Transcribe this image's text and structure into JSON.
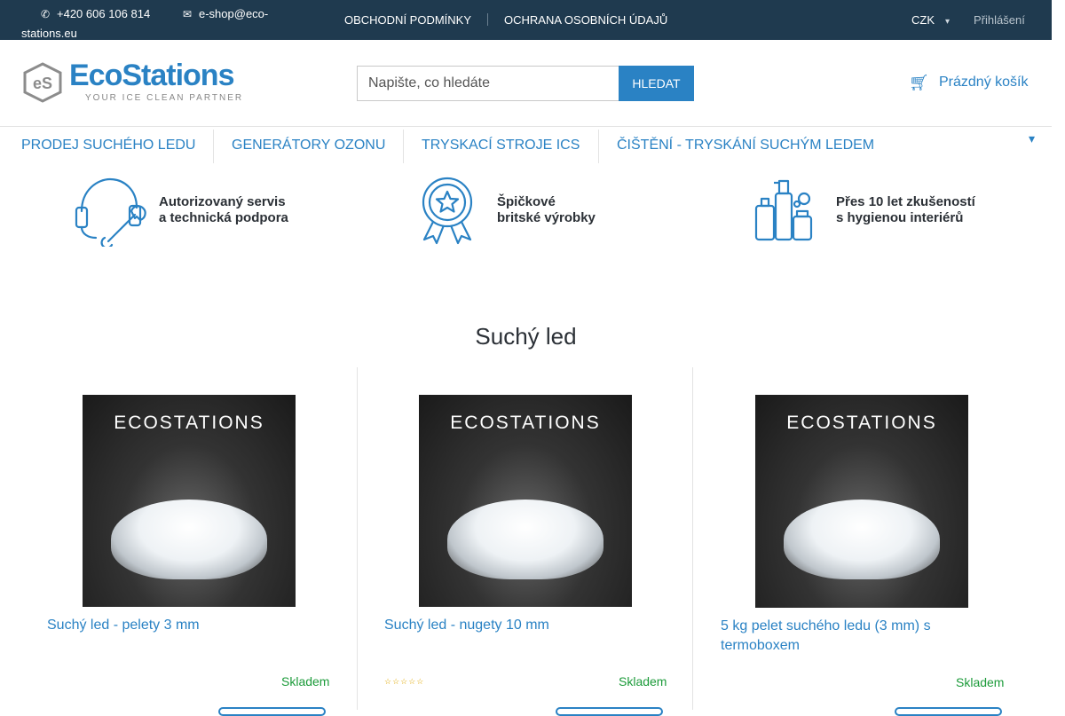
{
  "topbar": {
    "phone": "+420 606 106 814",
    "email_line1": "e-shop@eco-",
    "email_line2": "stations.eu",
    "links": [
      "OBCHODNÍ PODMÍNKY",
      "OCHRANA OSOBNÍCH ÚDAJŮ"
    ],
    "currency": "CZK",
    "login": "Přihlášení",
    "icons": {
      "phone": "phone-icon",
      "email": "envelope-icon",
      "currency_caret": "chevron-down-icon"
    }
  },
  "header": {
    "logo_word": "EcoStations",
    "logo_tagline": "YOUR ICE CLEAN PARTNER",
    "search_placeholder": "Napište, co hledáte",
    "search_button": "HLEDAT",
    "cart_label": "Prázdný košík",
    "cart_icon": "cart-icon"
  },
  "nav": {
    "items": [
      "PRODEJ SUCHÉHO LEDU",
      "GENERÁTORY OZONU",
      "TRYSKACÍ STROJE ICS",
      "ČIŠTĚNÍ - TRYSKÁNÍ SUCHÝM LEDEM"
    ],
    "more_icon": "chevron-down-icon"
  },
  "benefits": [
    {
      "line1": "Autorizovaný servis",
      "line2": "a technická podpora",
      "icon": "headset-wrench-icon"
    },
    {
      "line1": "Špičkové",
      "line2": "britské výrobky",
      "icon": "award-badge-icon"
    },
    {
      "line1": "Přes 10 let zkušeností",
      "line2": "s hygienou interiérů",
      "icon": "cleaning-bottles-icon"
    }
  ],
  "section_title": "Suchý led",
  "products": [
    {
      "name_line1": "Suchý led - pelety 3 mm",
      "name_line2": "",
      "stock": "Skladem",
      "photo_brand": "ECOSTATIONS",
      "rating_stars": 0
    },
    {
      "name_line1": "Suchý led - nugety 10 mm",
      "name_line2": "",
      "stock": "Skladem",
      "photo_brand": "ECOSTATIONS",
      "rating_stars": 5,
      "stars_text": "☆☆☆☆☆"
    },
    {
      "name_line1": "5 kg pelet suchého ledu (3 mm) s",
      "name_line2": "termoboxem",
      "stock": "Skladem",
      "photo_brand": "ECOSTATIONS",
      "rating_stars": 0
    }
  ],
  "colors": {
    "topbar_bg": "#1f3a4f",
    "accent": "#2a82c4",
    "stock_green": "#1c9b3a",
    "text_dark": "#2b3036"
  }
}
